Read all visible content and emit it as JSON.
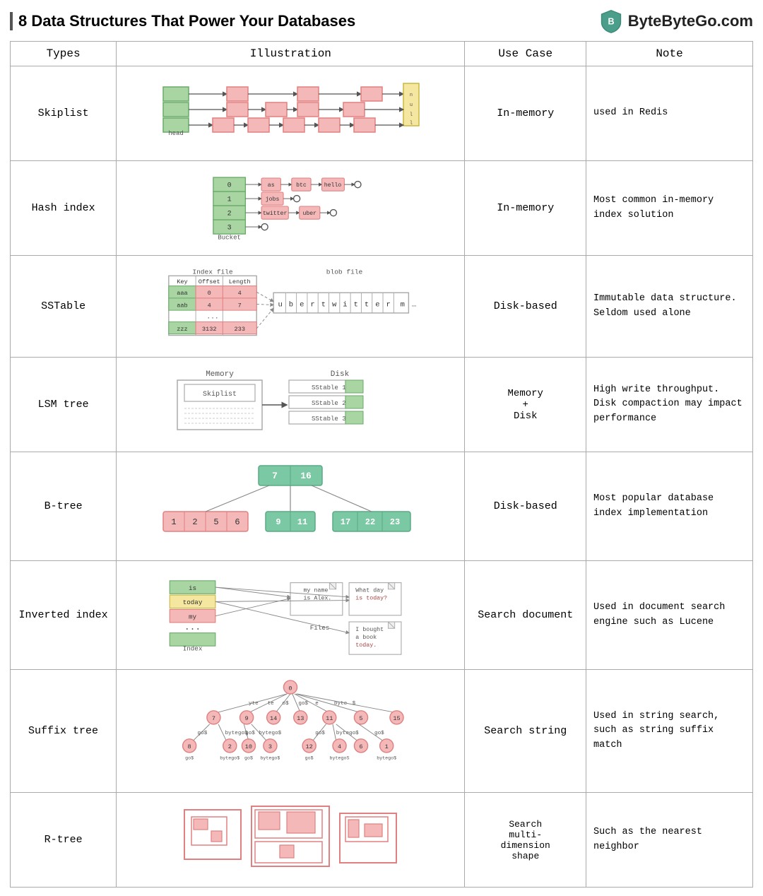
{
  "header": {
    "title": "8 Data Structures That Power Your Databases",
    "logo_text": "ByteByteGo.com"
  },
  "table": {
    "columns": [
      "Types",
      "Illustration",
      "Use Case",
      "Note"
    ],
    "rows": [
      {
        "type": "Skiplist",
        "use_case": "In-memory",
        "note": "used in Redis"
      },
      {
        "type": "Hash index",
        "use_case": "In-memory",
        "note": "Most common in-memory index solution"
      },
      {
        "type": "SSTable",
        "use_case": "Disk-based",
        "note": "Immutable data structure. Seldom used alone"
      },
      {
        "type": "LSM tree",
        "use_case": "Memory + Disk",
        "note": "High write throughput. Disk compaction may impact performance"
      },
      {
        "type": "B-tree",
        "use_case": "Disk-based",
        "note": "Most popular database index implementation"
      },
      {
        "type": "Inverted index",
        "use_case": "Search document",
        "note": "Used in document search engine such as Lucene"
      },
      {
        "type": "Suffix tree",
        "use_case": "Search string",
        "note": "Used in string search, such as string suffix match"
      },
      {
        "type": "R-tree",
        "use_case": "Search multi-dimension shape",
        "note": "Such as the nearest neighbor"
      }
    ]
  }
}
